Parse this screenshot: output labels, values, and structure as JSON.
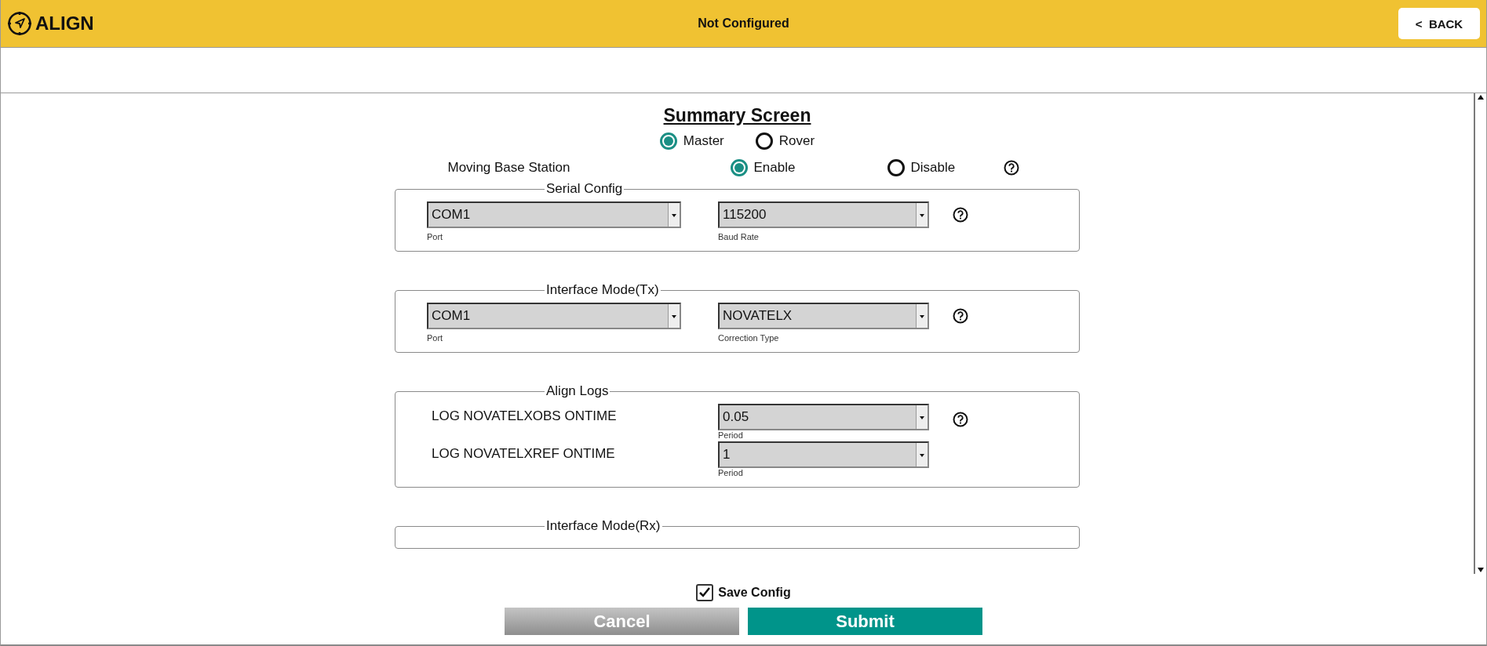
{
  "header": {
    "title": "ALIGN",
    "status": "Not Configured",
    "back_label": "<  BACK"
  },
  "summary": {
    "title": "Summary Screen",
    "role_options": [
      {
        "label": "Master",
        "selected": true
      },
      {
        "label": "Rover",
        "selected": false
      }
    ],
    "moving_base": {
      "label": "Moving Base Station",
      "options": [
        {
          "label": "Enable",
          "selected": true
        },
        {
          "label": "Disable",
          "selected": false
        }
      ]
    }
  },
  "sections": [
    {
      "kind": "selects",
      "legend": "Serial Config",
      "fields": [
        {
          "value": "COM1",
          "caption": "Port"
        },
        {
          "value": "115200",
          "caption": "Baud Rate"
        }
      ]
    },
    {
      "kind": "selects",
      "legend": "Interface Mode(Tx)",
      "fields": [
        {
          "value": "COM1",
          "caption": "Port"
        },
        {
          "value": "NOVATELX",
          "caption": "Correction Type"
        }
      ]
    },
    {
      "kind": "logs",
      "legend": "Align Logs",
      "rows": [
        {
          "label": "LOG NOVATELXOBS ONTIME",
          "value": "0.05",
          "caption": "Period"
        },
        {
          "label": "LOG NOVATELXREF ONTIME",
          "value": "1",
          "caption": "Period"
        }
      ]
    },
    {
      "kind": "selects",
      "legend": "Interface Mode(Rx)"
    }
  ],
  "save_config": {
    "label": "Save Config",
    "checked": true
  },
  "buttons": [
    {
      "label": "Cancel",
      "kind": "secondary"
    },
    {
      "label": "Submit",
      "kind": "primary"
    }
  ]
}
